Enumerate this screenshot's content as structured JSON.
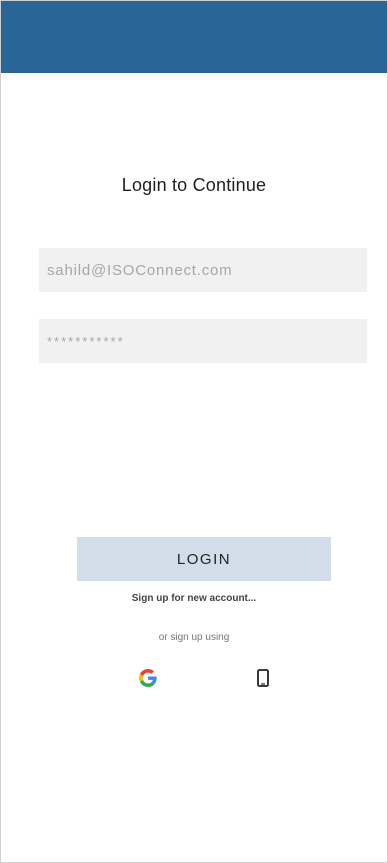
{
  "app_bar": {
    "color": "#2a6598"
  },
  "login": {
    "title": "Login to Continue",
    "email_value": "sahild@ISOConnect.com",
    "password_mask": "***********",
    "button_label": "LOGIN",
    "signup_link": "Sign up for new account...",
    "alternative_text": "or sign up using"
  },
  "icons": {
    "google": "google-icon",
    "phone": "phone-icon"
  },
  "colors": {
    "button_background": "#d2dde9",
    "field_background": "#f1f1f1"
  }
}
